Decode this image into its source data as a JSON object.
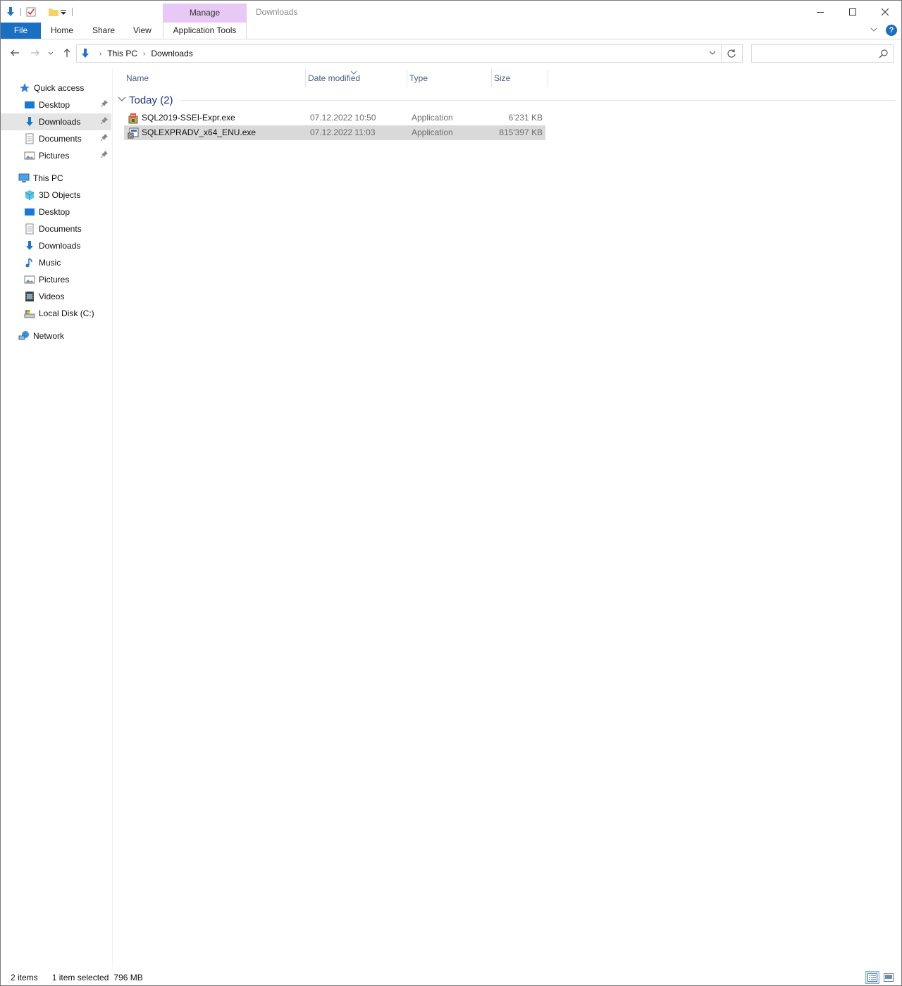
{
  "window": {
    "title": "Downloads",
    "context_tab": "Manage"
  },
  "ribbon": {
    "tabs": [
      "File",
      "Home",
      "Share",
      "View",
      "Application Tools"
    ]
  },
  "address": {
    "crumbs": [
      "This PC",
      "Downloads"
    ]
  },
  "search": {
    "placeholder": ""
  },
  "navpane": {
    "quick_access": "Quick access",
    "quick_items": [
      "Desktop",
      "Downloads",
      "Documents",
      "Pictures"
    ],
    "this_pc": "This PC",
    "pc_items": [
      "3D Objects",
      "Desktop",
      "Documents",
      "Downloads",
      "Music",
      "Pictures",
      "Videos",
      "Local Disk (C:)"
    ],
    "network": "Network"
  },
  "filelist": {
    "columns": [
      "Name",
      "Date modified",
      "Type",
      "Size"
    ],
    "group": "Today (2)",
    "rows": [
      {
        "name": "SQL2019-SSEI-Expr.exe",
        "date": "07.12.2022 10:50",
        "type": "Application",
        "size": "6'231 KB"
      },
      {
        "name": "SQLEXPRADV_x64_ENU.exe",
        "date": "07.12.2022 11:03",
        "type": "Application",
        "size": "815'397 KB"
      }
    ]
  },
  "status": {
    "items": "2 items",
    "selected": "1 item selected",
    "size": "796 MB"
  },
  "colors": {
    "accent": "#1a6fc2",
    "context_tab": "#e8c8f4",
    "selection": "#d9d9d9",
    "group_title": "#1e3287"
  }
}
